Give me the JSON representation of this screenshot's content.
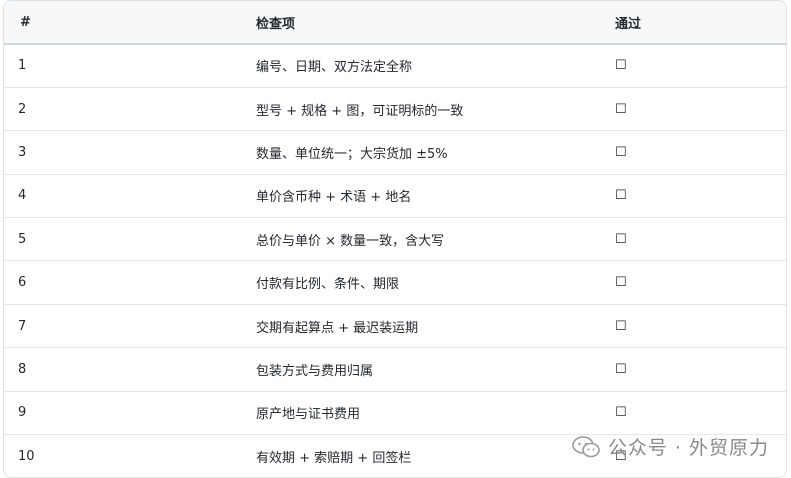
{
  "table": {
    "headers": [
      "#",
      "检查项",
      "通过"
    ],
    "rows": [
      {
        "num": "1",
        "item": "编号、日期、双方法定全称",
        "check": "☐"
      },
      {
        "num": "2",
        "item": "型号 + 规格 + 图，可证明标的一致",
        "check": "☐"
      },
      {
        "num": "3",
        "item": "数量、单位统一；大宗货加 ±5%",
        "check": "☐"
      },
      {
        "num": "4",
        "item": "单价含币种 + 术语 + 地名",
        "check": "☐"
      },
      {
        "num": "5",
        "item": "总价与单价 × 数量一致，含大写",
        "check": "☐"
      },
      {
        "num": "6",
        "item": "付款有比例、条件、期限",
        "check": "☐"
      },
      {
        "num": "7",
        "item": "交期有起算点 + 最迟装运期",
        "check": "☐"
      },
      {
        "num": "8",
        "item": "包装方式与费用归属",
        "check": "☐"
      },
      {
        "num": "9",
        "item": "原产地与证书费用",
        "check": "☐"
      },
      {
        "num": "10",
        "item": "有效期 + 索赔期 + 回签栏",
        "check": "☐"
      }
    ]
  },
  "watermark": {
    "text": "公众号 · 外贸原力",
    "icon": "wechat-icon"
  }
}
